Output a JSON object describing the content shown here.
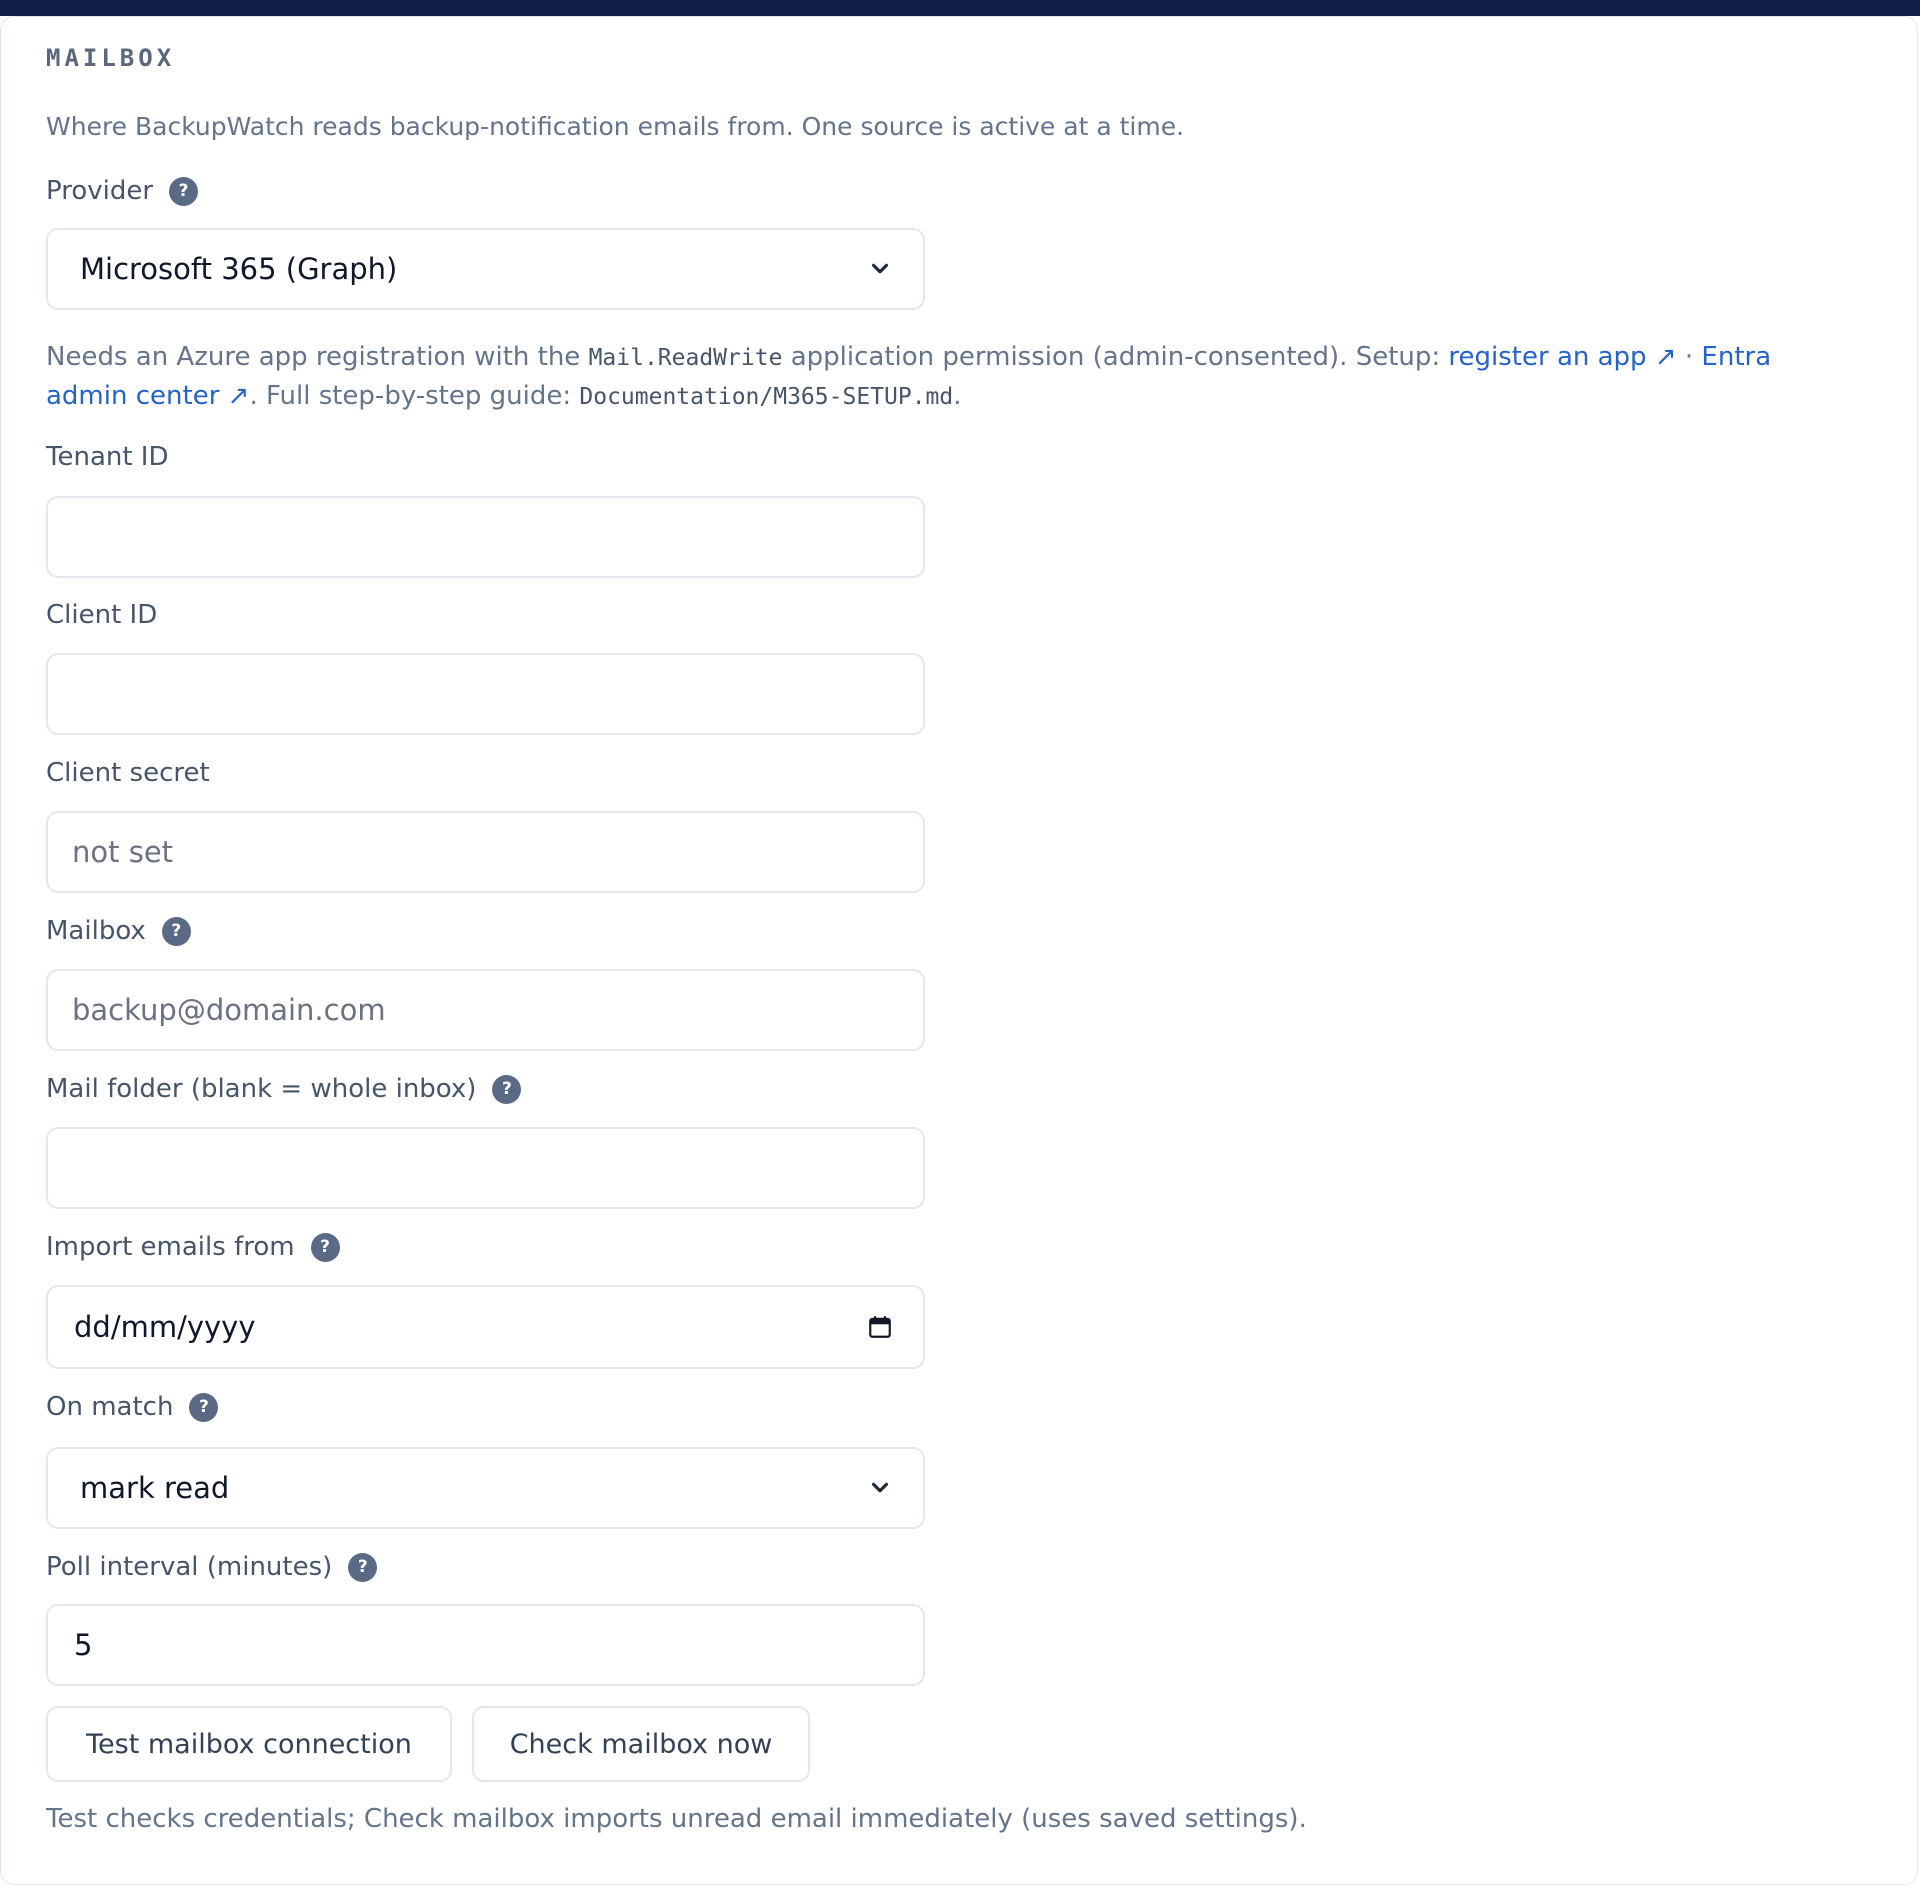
{
  "section": {
    "title": "MAILBOX",
    "description": "Where BackupWatch reads backup-notification emails from. One source is active at a time."
  },
  "provider": {
    "label": "Provider",
    "help": "?",
    "selected": "Microsoft 365 (Graph)"
  },
  "setup_note": {
    "t1": "Needs an Azure app registration with the ",
    "code1": "Mail.ReadWrite",
    "t2": " application permission (admin-consented). Setup: ",
    "link1": "register an app ↗",
    "sep": " · ",
    "link2": "Entra admin center ↗",
    "t3": ". Full step-by-step guide: ",
    "code2": "Documentation/M365-SETUP.md",
    "t4": "."
  },
  "fields": {
    "tenant": {
      "label": "Tenant ID",
      "value": ""
    },
    "client": {
      "label": "Client ID",
      "value": ""
    },
    "secret": {
      "label": "Client secret",
      "placeholder": "not set"
    },
    "mailbox": {
      "label": "Mailbox",
      "help": "?",
      "placeholder": "backup@domain.com"
    },
    "folder": {
      "label": "Mail folder (blank = whole inbox)",
      "help": "?",
      "value": ""
    },
    "import_from": {
      "label": "Import emails from",
      "help": "?",
      "placeholder": "dd/mm/yyyy"
    },
    "on_match": {
      "label": "On match",
      "help": "?",
      "selected": "mark read"
    },
    "poll": {
      "label": "Poll interval (minutes)",
      "help": "?",
      "value": "5"
    }
  },
  "buttons": {
    "test": "Test mailbox connection",
    "check": "Check mailbox now"
  },
  "footer_note": "Test checks credentials; Check mailbox imports unread email immediately (uses saved settings).",
  "colors": {
    "accent_link": "#2563c9",
    "topbar": "#0f1f45",
    "help_badge": "#5a6a85"
  }
}
